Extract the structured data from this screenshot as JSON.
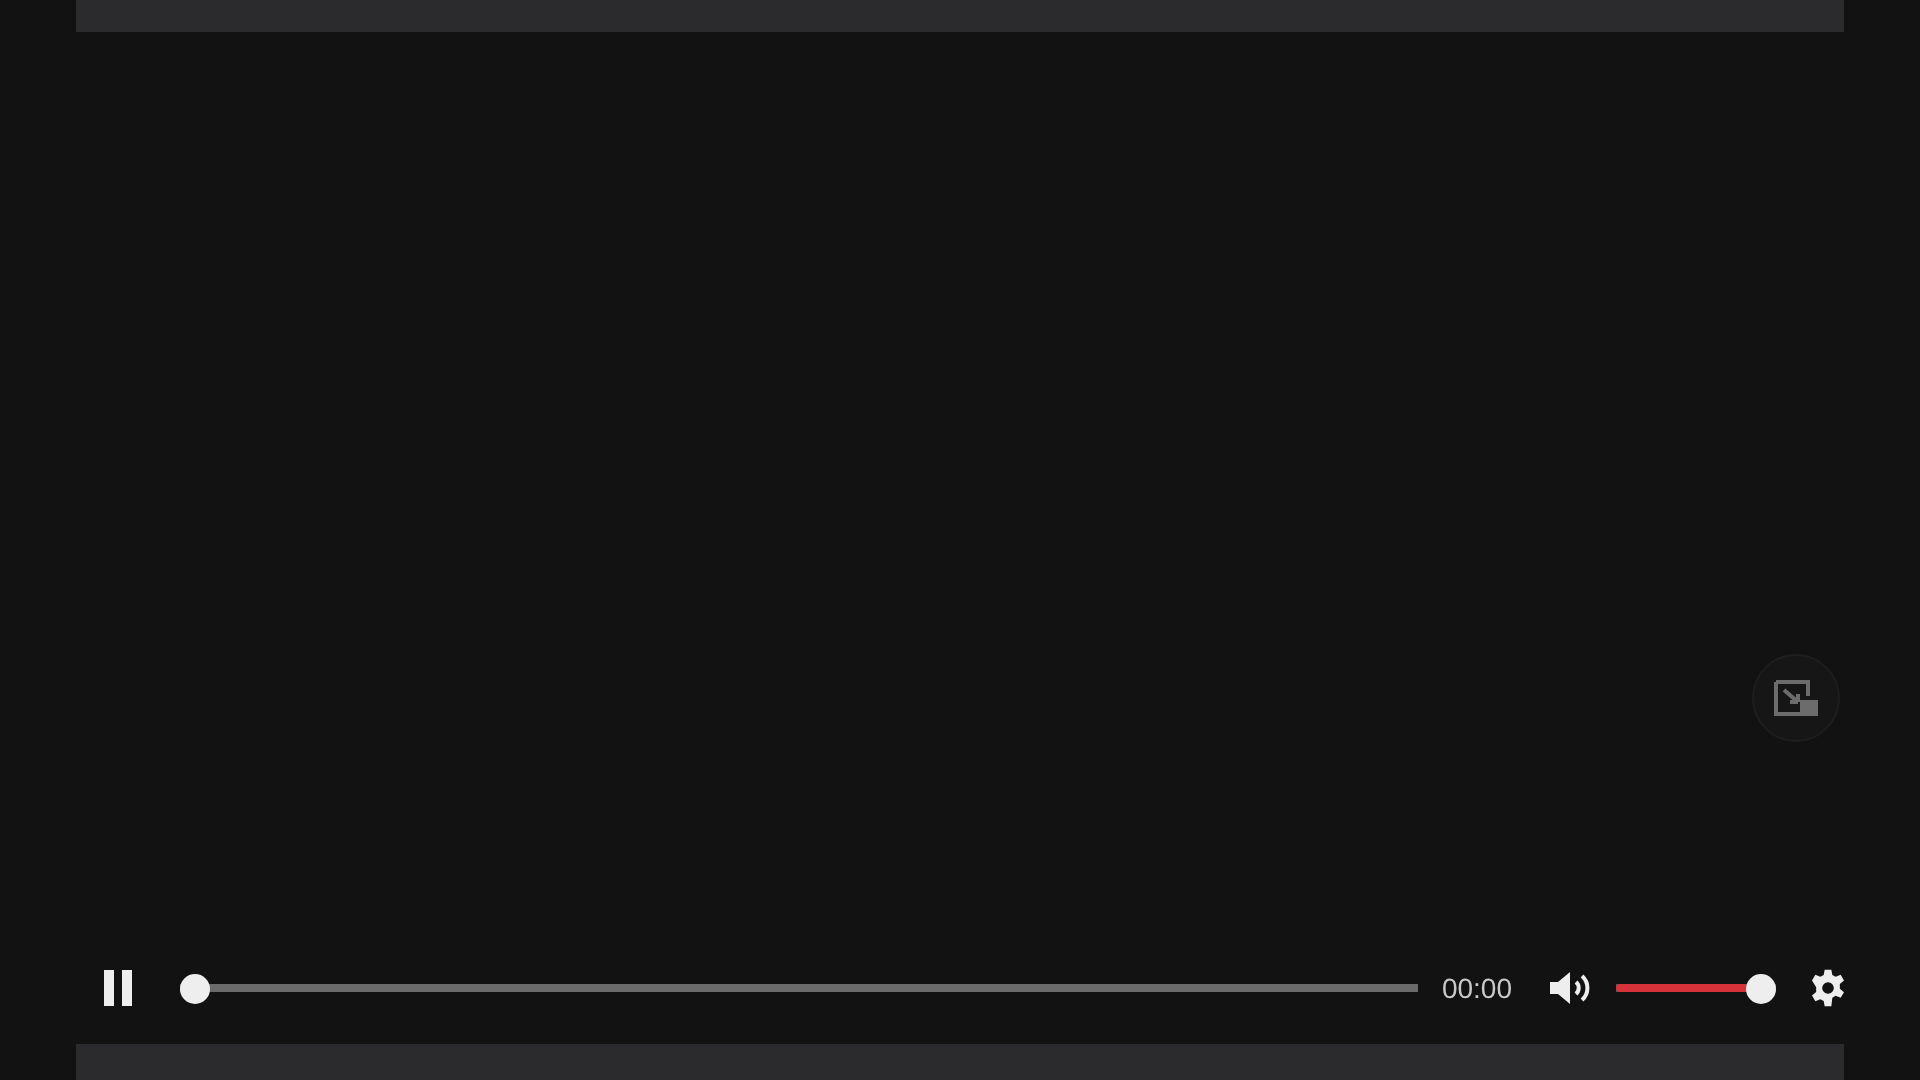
{
  "player": {
    "paused": false,
    "progress": {
      "level": 0
    },
    "time": "00:00",
    "muted": false,
    "volume": {
      "level": 1
    }
  }
}
